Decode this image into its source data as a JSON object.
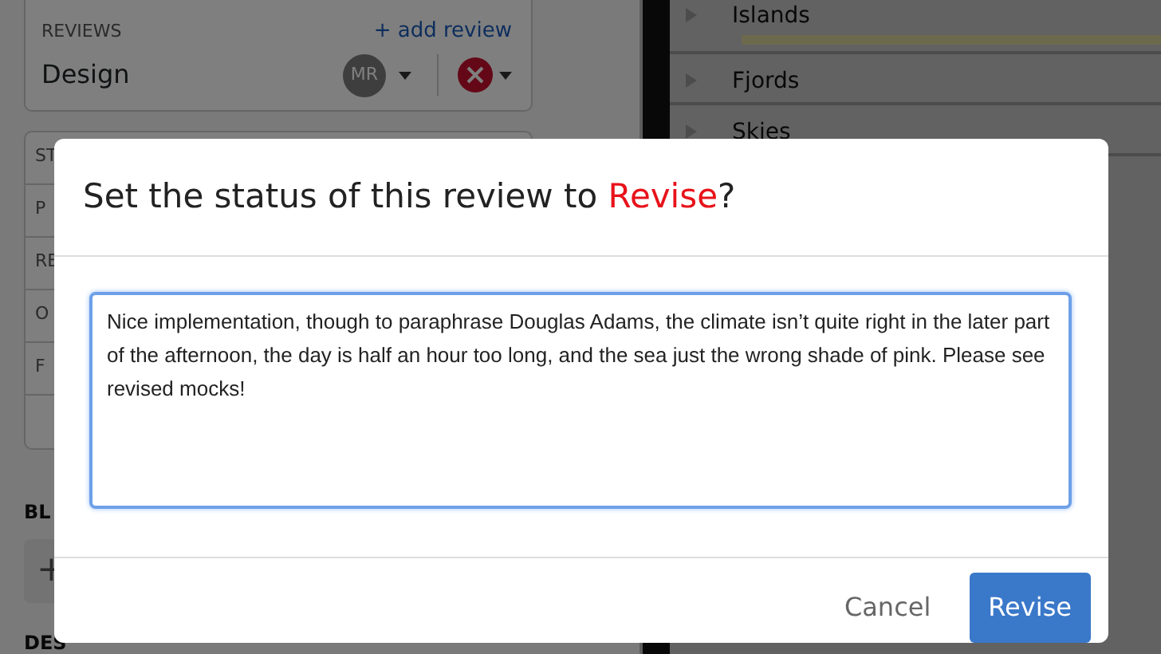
{
  "background": {
    "reviews": {
      "heading": "REVIEWS",
      "add_link": "+ add review",
      "rows": [
        {
          "name": "Design",
          "avatar": "MR",
          "rejected": true
        }
      ]
    },
    "field_labels": [
      "ST",
      "P",
      "RE",
      "O",
      "F"
    ],
    "blocks_heading": "BL",
    "add_block": "+",
    "description_heading": "DES",
    "tree": [
      {
        "label": "Islands",
        "expanded": false,
        "progress": true
      },
      {
        "label": "Fjords",
        "expanded": false,
        "progress": false
      },
      {
        "label": "Skies",
        "expanded": false,
        "progress": false
      }
    ]
  },
  "dialog": {
    "title_parts": [
      {
        "text": "Set the status of this review to ",
        "emphasis": false
      },
      {
        "text": "Revise",
        "emphasis": true
      },
      {
        "text": "?",
        "emphasis": false
      }
    ],
    "comment": "Nice implementation, though to paraphrase Douglas Adams, the climate isn’t quite right in the later part of the afternoon, the day is half an hour too long, and the sea just the wrong shade of pink. Please see revised mocks!",
    "buttons": [
      {
        "label": "Cancel",
        "kind": "secondary"
      },
      {
        "label": "Revise",
        "kind": "primary"
      }
    ]
  }
}
